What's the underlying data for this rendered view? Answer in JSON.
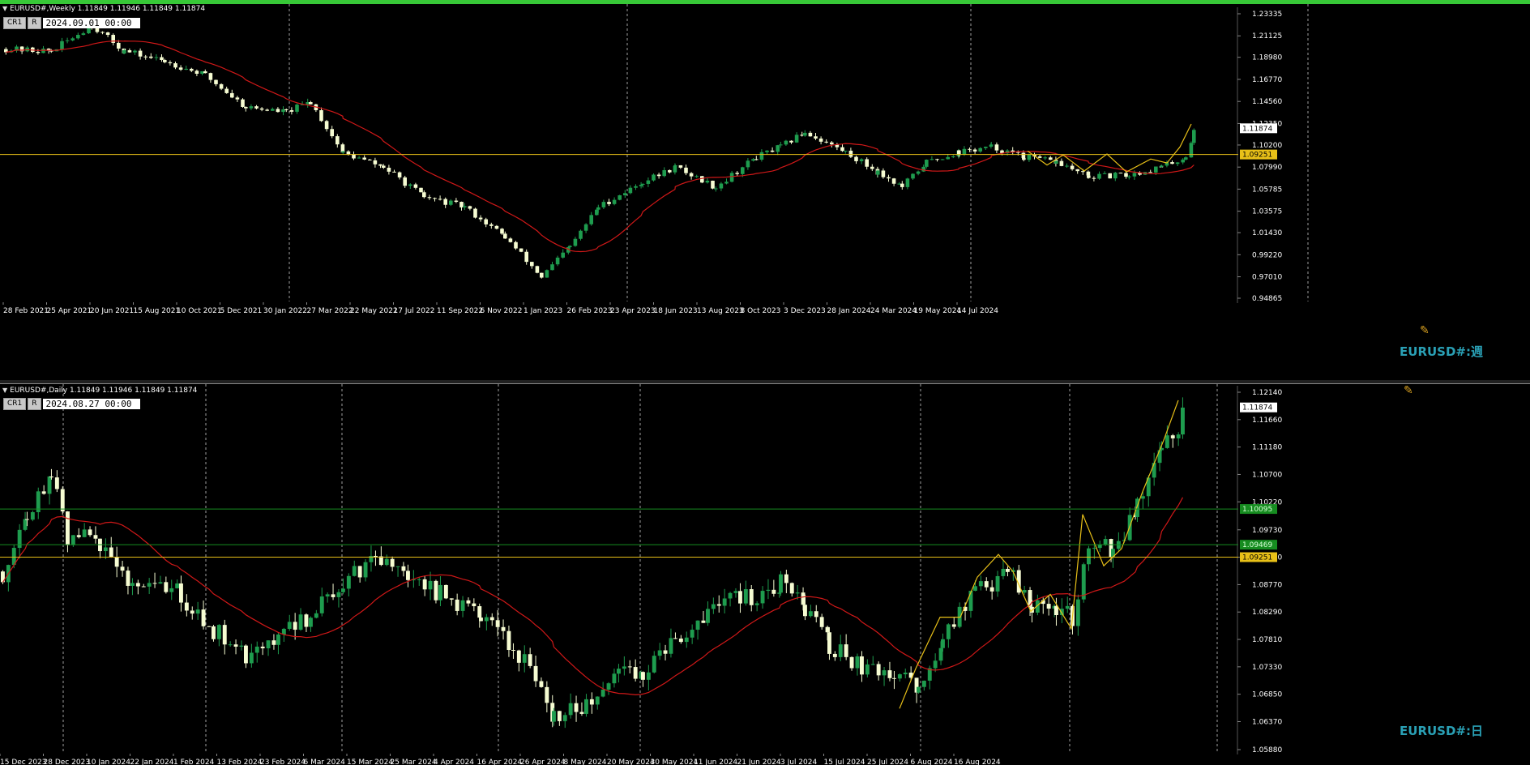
{
  "colors": {
    "bull": "#1e9c4e",
    "bear": "#f6fcd2",
    "ma": "#d01818",
    "swing": "#e8c018",
    "hline_yellow": "#e8c018",
    "hline_green": "#168c20",
    "grid": "#c8c8c8",
    "axis_text": "#ffffff",
    "watermark": "#2aa0b5",
    "border_green": "#37c837"
  },
  "icons": {
    "tool": "pencil-ruler-icon",
    "collapse": "triangle-down-icon"
  },
  "top_chart": {
    "header": "EURUSD#,Weekly  1.11849 1.11946 1.11849 1.11874",
    "btn_cr": "CR1",
    "btn_r": "R",
    "datetime": "2024.09.01 00:00",
    "watermark": "EURUSD#:週",
    "y_ticks": [
      "1.23335",
      "1.21125",
      "1.18980",
      "1.16770",
      "1.14560",
      "1.12350",
      "1.10200",
      "1.07990",
      "1.05785",
      "1.03575",
      "1.01430",
      "0.99220",
      "0.97010",
      "0.94865"
    ],
    "x_ticks": [
      "28 Feb 2021",
      "25 Apr 2021",
      "20 Jun 2021",
      "15 Aug 2021",
      "10 Oct 2021",
      "5 Dec 2021",
      "30 Jan 2022",
      "27 Mar 2022",
      "22 May 2022",
      "17 Jul 2022",
      "11 Sep 2022",
      "6 Nov 2022",
      "1 Jan 2023",
      "26 Feb 2023",
      "23 Apr 2023",
      "18 Jun 2023",
      "13 Aug 2023",
      "8 Oct 2023",
      "3 Dec 2023",
      "28 Jan 2024",
      "24 Mar 2024",
      "19 May 2024",
      "14 Jul 2024"
    ],
    "price_tags": [
      {
        "value": 1.11874,
        "label": "1.11874",
        "style": "current"
      },
      {
        "value": 1.09251,
        "label": "1.09251",
        "style": "yellow"
      }
    ],
    "ylim": [
      0.94865,
      1.23335
    ]
  },
  "bottom_chart": {
    "header": "EURUSD#,Daily  1.11849 1.11946 1.11849 1.11874",
    "btn_cr": "CR1",
    "btn_r": "R",
    "datetime": "2024.08.27 00:00",
    "watermark": "EURUSD#:日",
    "y_ticks": [
      "1.12140",
      "1.11660",
      "1.11180",
      "1.10700",
      "1.10220",
      "1.09730",
      "1.09250",
      "1.08770",
      "1.08290",
      "1.07810",
      "1.07330",
      "1.06850",
      "1.06370",
      "1.05880"
    ],
    "x_ticks": [
      "15 Dec 2023",
      "28 Dec 2023",
      "10 Jan 2024",
      "22 Jan 2024",
      "1 Feb 2024",
      "13 Feb 2024",
      "23 Feb 2024",
      "6 Mar 2024",
      "15 Mar 2024",
      "25 Mar 2024",
      "4 Apr 2024",
      "16 Apr 2024",
      "26 Apr 2024",
      "8 May 2024",
      "20 May 2024",
      "30 May 2024",
      "11 Jun 2024",
      "21 Jun 2024",
      "3 Jul 2024",
      "15 Jul 2024",
      "25 Jul 2024",
      "6 Aug 2024",
      "16 Aug 2024"
    ],
    "price_tags": [
      {
        "value": 1.11874,
        "label": "1.11874",
        "style": "current"
      },
      {
        "value": 1.10095,
        "label": "1.10095",
        "style": "green"
      },
      {
        "value": 1.09469,
        "label": "1.09469",
        "style": "green"
      },
      {
        "value": 1.09251,
        "label": "1.09251",
        "style": "yellow"
      }
    ],
    "ylim": [
      1.0588,
      1.1214
    ]
  }
}
